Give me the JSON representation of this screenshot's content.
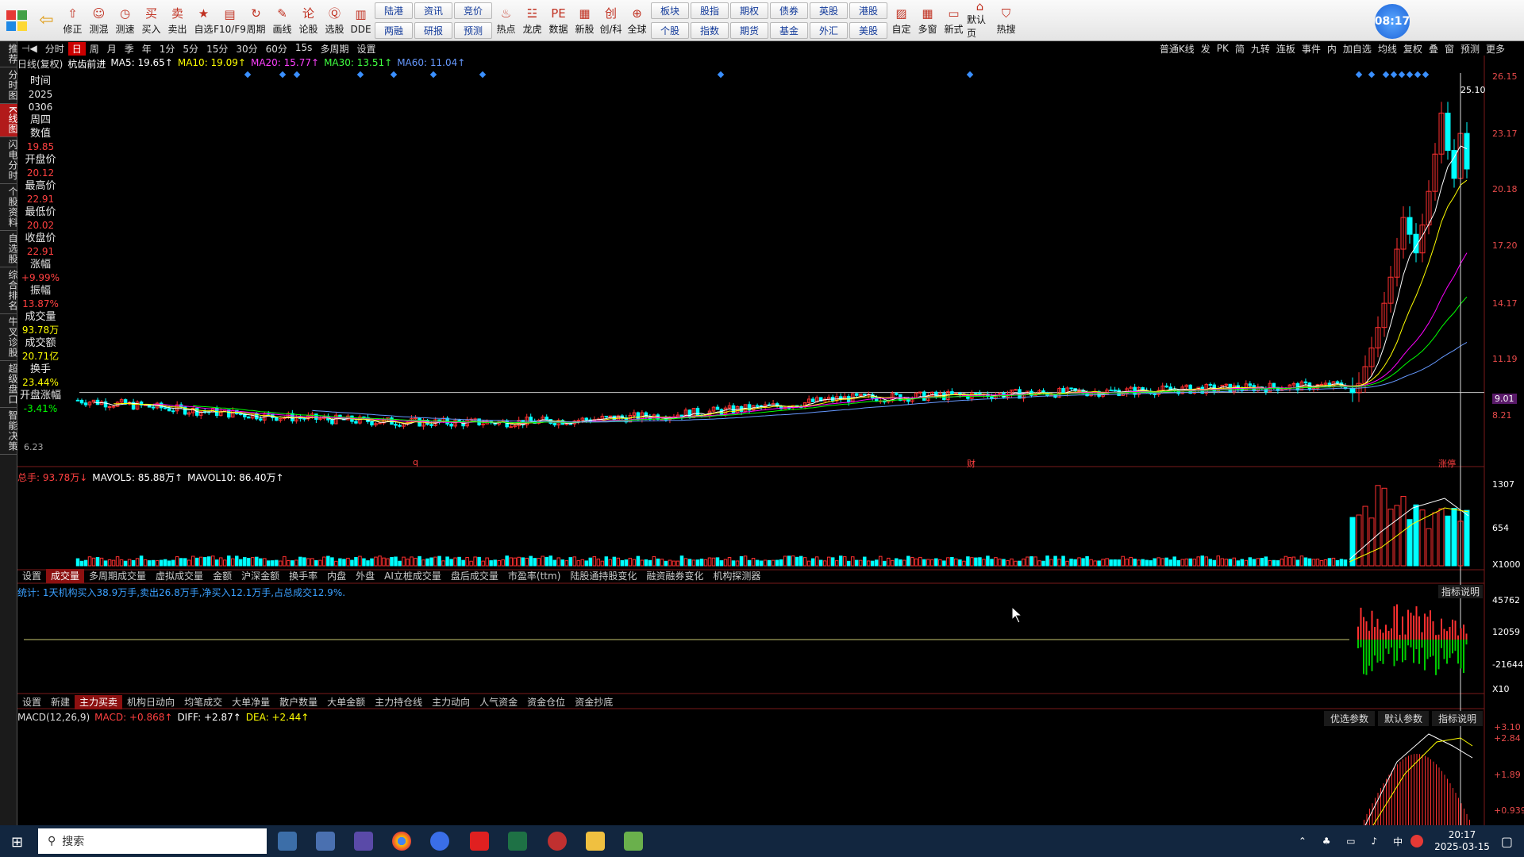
{
  "toolbar": {
    "items": [
      {
        "icon": "up-arrow-icon",
        "label": "修正",
        "sym": "⇧"
      },
      {
        "icon": "smile-icon",
        "label": "测混",
        "sym": "☺"
      },
      {
        "icon": "clock-icon",
        "label": "测速",
        "sym": "◷"
      },
      {
        "icon": "buy-icon",
        "label": "买入",
        "sym": "买"
      },
      {
        "icon": "sell-icon",
        "label": "卖出",
        "sym": "卖"
      },
      {
        "icon": "star-icon",
        "label": "自选",
        "sym": "★"
      },
      {
        "icon": "chart-icon",
        "label": "F10/F9",
        "sym": "▤"
      },
      {
        "icon": "cycle-icon",
        "label": "周期",
        "sym": "↻"
      },
      {
        "icon": "pen-icon",
        "label": "画线",
        "sym": "✎"
      },
      {
        "icon": "comment-icon",
        "label": "论股",
        "sym": "论"
      },
      {
        "icon": "select-icon",
        "label": "选股",
        "sym": "Ⓠ"
      },
      {
        "icon": "dde-icon",
        "label": "DDE",
        "sym": "▥"
      }
    ],
    "pairs": [
      [
        "陆港",
        "两融"
      ],
      [
        "资讯",
        "研报"
      ],
      [
        "竞价",
        "预测"
      ]
    ],
    "items2": [
      {
        "icon": "fire-icon",
        "label": "热点",
        "sym": "♨"
      },
      {
        "icon": "dragon-icon",
        "label": "龙虎",
        "sym": "☳"
      },
      {
        "icon": "pe-icon",
        "label": "数据",
        "sym": "PE"
      },
      {
        "icon": "newstock-icon",
        "label": "新股",
        "sym": "▦"
      },
      {
        "icon": "chuang-icon",
        "label": "创/科",
        "sym": "创"
      },
      {
        "icon": "globe-icon",
        "label": "全球",
        "sym": "⊕"
      }
    ],
    "pairs2": [
      [
        "板块",
        "个股"
      ],
      [
        "股指",
        "指数"
      ],
      [
        "期权",
        "期货"
      ],
      [
        "债券",
        "基金"
      ],
      [
        "英股",
        "外汇"
      ],
      [
        "港股",
        "美股"
      ]
    ],
    "items3": [
      {
        "icon": "custom-icon",
        "label": "自定",
        "sym": "▨"
      },
      {
        "icon": "multiwindow-icon",
        "label": "多窗",
        "sym": "▦"
      },
      {
        "icon": "newstyle-icon",
        "label": "新式",
        "sym": "▭"
      },
      {
        "icon": "home-icon",
        "label": "默认页",
        "sym": "⌂"
      },
      {
        "icon": "hotsearch-icon",
        "label": "热搜",
        "sym": "⛉"
      }
    ],
    "clock": "08:17"
  },
  "left_tabs": [
    "推荐",
    "分时图",
    "K线图",
    "闪电分时",
    "个股资料",
    "自选股",
    "综合排名",
    "牛叉诊股",
    "超级盘口",
    "智能决策"
  ],
  "period_bar": {
    "items": [
      "分时",
      "日",
      "周",
      "月",
      "季",
      "年",
      "1分",
      "5分",
      "15分",
      "30分",
      "60分",
      "15s",
      "多周期",
      "设置"
    ],
    "active": "日"
  },
  "right_bar": [
    "普通K线",
    "发",
    "PK",
    "简",
    "九转",
    "连板",
    "事件",
    "内",
    "加自选",
    "均线",
    "复权",
    "叠",
    "窗",
    "预测",
    "更多"
  ],
  "ma_bar": {
    "name": "日线(复权)",
    "title": "杭齿前进",
    "ma5": "MA5: 19.65↑",
    "ma10": "MA10: 19.09↑",
    "ma20": "MA20: 15.77↑",
    "ma30": "MA30: 13.51↑",
    "ma60": "MA60: 11.04↑"
  },
  "info": [
    {
      "label": "时间",
      "value": "2025"
    },
    {
      "label": "",
      "value": "0306"
    },
    {
      "label": "周四",
      "value": ""
    },
    {
      "label": "数值",
      "value": "19.85"
    },
    {
      "label": "开盘价",
      "value": "20.12"
    },
    {
      "label": "最高价",
      "value": "22.91"
    },
    {
      "label": "最低价",
      "value": "20.02"
    },
    {
      "label": "收盘价",
      "value": "22.91"
    },
    {
      "label": "涨幅",
      "value": "+9.99%"
    },
    {
      "label": "振幅",
      "value": "13.87%"
    },
    {
      "label": "成交量",
      "value": "93.78万"
    },
    {
      "label": "成交额",
      "value": "20.71亿"
    },
    {
      "label": "换手",
      "value": "23.44%"
    },
    {
      "label": "开盘涨幅",
      "value": "-3.41%"
    }
  ],
  "price_axis": [
    "26.15",
    "23.17",
    "20.18",
    "17.20",
    "14.17",
    "11.19",
    "9.01",
    "8.21"
  ],
  "price_low": "6.23",
  "price_marker_high": "25.10",
  "chart_markers": [
    "q",
    "财",
    "涨停"
  ],
  "vol_bar": {
    "label": "总手: 93.78万↓",
    "mavol5": "MAVOL5: 85.88万↑",
    "mavol10": "MAVOL10: 86.40万↑",
    "axis": [
      "1307",
      "654",
      "X1000"
    ]
  },
  "vol_tabs": [
    "设置",
    "成交量",
    "多周期成交量",
    "虚拟成交量",
    "金额",
    "沪深金额",
    "换手率",
    "内盘",
    "外盘",
    "AI立桩成交量",
    "盘后成交量",
    "市盈率(ttm)",
    "陆股通持股变化",
    "融资融券变化",
    "机构探测器"
  ],
  "inst_bar": {
    "text": "统计: 1天机构买入38.9万手,卖出26.8万手,净买入12.1万手,占总成交12.9%.",
    "explain": "指标说明",
    "axis": [
      "45762",
      "12059",
      "-21644",
      "X10"
    ]
  },
  "main_tabs": [
    "设置",
    "新建",
    "主力买卖",
    "机构日动向",
    "均笔成交",
    "大单净量",
    "散户数量",
    "大单金额",
    "主力持仓线",
    "主力动向",
    "人气资金",
    "资金仓位",
    "资金抄底"
  ],
  "macd_bar": {
    "name": "MACD(12,26,9)",
    "macd": "MACD: +0.868↑",
    "diff": "DIFF: +2.87↑",
    "dea": "DEA: +2.44↑",
    "btns": [
      "优选参数",
      "默认参数",
      "指标说明"
    ],
    "axis": [
      "+3.10",
      "+2.84",
      "+1.89",
      "+0.939"
    ]
  },
  "taskbar": {
    "search": "搜索",
    "time": "20:17",
    "date": "2025-03-15",
    "lang": "中"
  },
  "colors": {
    "up": "#ff3030",
    "down": "#00ffff",
    "ma5": "#ffffff",
    "ma10": "#ffff00",
    "ma20": "#ff00ff",
    "ma30": "#00ff00",
    "ma60": "#6699ff"
  },
  "chart_data": {
    "type": "candlestick",
    "title": "杭齿前进",
    "series": [
      {
        "name": "MA5",
        "last": 19.65
      },
      {
        "name": "MA10",
        "last": 19.09
      },
      {
        "name": "MA20",
        "last": 15.77
      },
      {
        "name": "MA30",
        "last": 13.51
      },
      {
        "name": "MA60",
        "last": 11.04
      }
    ],
    "close_recent": [
      9.0,
      9.5,
      10.4,
      11.4,
      12.5,
      13.8,
      15.2,
      16.7,
      18.4,
      17.5,
      16.5,
      18.0,
      19.8,
      21.8,
      24.0,
      22.0,
      20.5,
      22.91,
      21.0
    ],
    "ylim": [
      6.23,
      26.15
    ]
  }
}
